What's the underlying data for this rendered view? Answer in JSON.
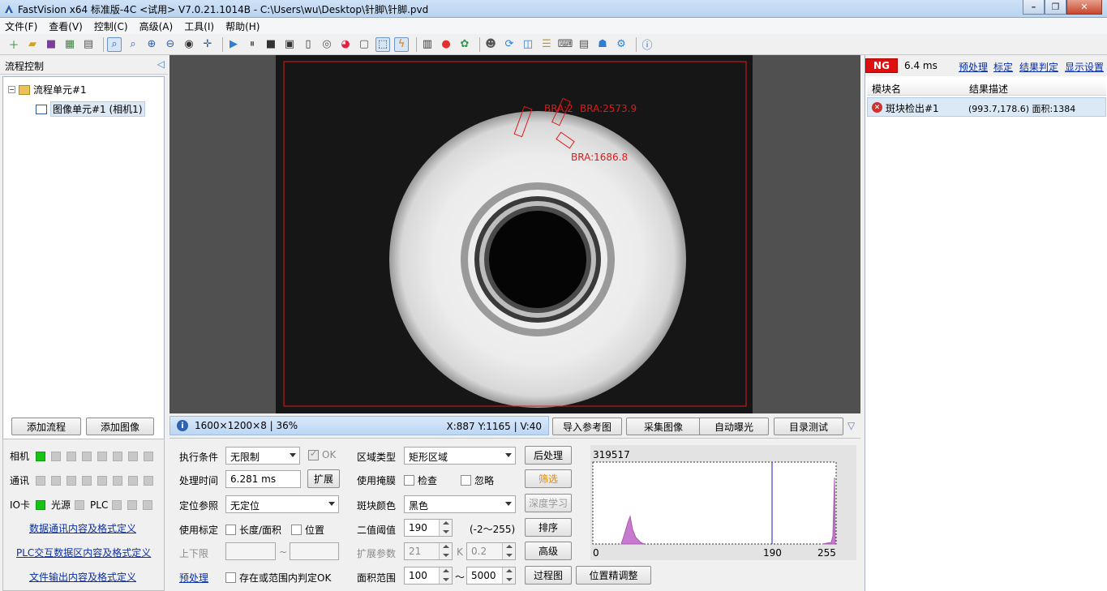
{
  "window": {
    "title": "FastVision x64 标准版-4C <试用> V7.0.21.1014B - C:\\Users\\wu\\Desktop\\针脚\\针脚.pvd",
    "minimize": "–",
    "maximize": "❐",
    "close": "✕"
  },
  "menu": [
    "文件(F)",
    "查看(V)",
    "控制(C)",
    "高级(A)",
    "工具(I)",
    "帮助(H)"
  ],
  "toolbar_icons": [
    "new-icon",
    "open-icon",
    "save-icon",
    "table-icon",
    "print-icon",
    "zoom-fit-icon",
    "zoom-search-icon",
    "zoom-in-icon",
    "zoom-out-icon",
    "eye-icon",
    "crosshair-icon",
    "play-icon",
    "pause-icon",
    "stop-icon",
    "fit-frame-icon",
    "camera-file-icon",
    "camera-icon",
    "color-wheel-icon",
    "mouse-icon",
    "select-region-icon",
    "flash-icon",
    "io-icon",
    "location-icon",
    "refresh-icon",
    "users-icon",
    "sync-icon",
    "window-icon",
    "list-icon",
    "keyboard-icon",
    "print2-icon",
    "robot-icon",
    "gear-icon",
    "info-icon"
  ],
  "left": {
    "header": "流程控制",
    "tree": {
      "root": "流程单元#1",
      "child": "图像单元#1 (相机1)"
    },
    "buttons": {
      "add_flow": "添加流程",
      "add_image": "添加图像"
    },
    "status": {
      "camera": "相机",
      "comm": "通讯",
      "io": "IO卡",
      "light": "光源",
      "plc": "PLC"
    },
    "links": [
      "数据通讯内容及格式定义",
      "PLC交互数据区内容及格式定义",
      "文件输出内容及格式定义"
    ]
  },
  "view": {
    "labels": [
      "BRA:2",
      "BRA:2573.9",
      "BRA:1686.8"
    ]
  },
  "infobar": {
    "info": "1600×1200×8 | 36%",
    "coords": "X:887 Y:1165 | V:40"
  },
  "view_buttons": [
    "导入参考图",
    "采集图像",
    "自动曝光",
    "目录测试"
  ],
  "params": {
    "exec_label": "执行条件",
    "exec_value": "无限制",
    "ok_label": "OK",
    "time_label": "处理时间",
    "time_value": "6.281 ms",
    "expand": "扩展",
    "loc_label": "定位参照",
    "loc_value": "无定位",
    "calib_label": "使用标定",
    "len_area": "长度/面积",
    "position": "位置",
    "limit_label": "上下限",
    "tilde": "~",
    "preproc_link": "预处理",
    "exist_check": "存在或范围内判定OK",
    "region_type_label": "区域类型",
    "region_type_value": "矩形区域",
    "postproc": "后处理",
    "mask_label": "使用掩膜",
    "check": "检查",
    "ignore": "忽略",
    "filter": "筛选",
    "blob_color_label": "斑块颜色",
    "blob_color_value": "黑色",
    "deep_learn": "深度学习",
    "thresh_label": "二值阈值",
    "thresh_value": "190",
    "thresh_range": "(-2～255)",
    "sort": "排序",
    "ext_label": "扩展参数",
    "ext_value": "21",
    "k": "K",
    "ext_k_value": "0.2",
    "advanced": "高级",
    "area_label": "面积范围",
    "area_min": "100",
    "area_tilde": "～",
    "area_max": "5000",
    "process_img": "过程图",
    "pos_fine": "位置精调整"
  },
  "histogram": {
    "max_count": "319517",
    "threshold": "190",
    "x_min": "0",
    "x_max": "255"
  },
  "right": {
    "status": "NG",
    "cycle": "6.4 ms",
    "links": [
      "预处理",
      "标定",
      "结果判定",
      "显示设置"
    ],
    "col_name": "模块名",
    "col_desc": "结果描述",
    "row_name": "斑块检出#1",
    "row_desc": "(993.7,178.6) 面积:1384"
  },
  "colors": {
    "ng": "#e00f0f",
    "led_on": "#16c316",
    "roi": "#ff2020",
    "hist": "#c87ad0"
  }
}
